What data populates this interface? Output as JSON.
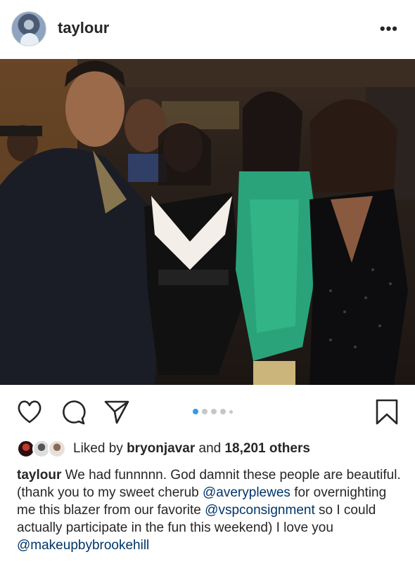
{
  "post": {
    "username": "taylour",
    "more_label": "•••"
  },
  "carousel": {
    "dot_count": 5,
    "active_index": 0
  },
  "likes": {
    "prefix": "Liked by",
    "user": "bryonjavar",
    "connector": "and",
    "count": "18,201 others"
  },
  "caption": {
    "username": "taylour",
    "part1": " We had funnnnn. God damnit these people are beautiful. (thank you to my sweet cherub ",
    "mention1": "@averyplewes",
    "part2": " for overnighting me this blazer from our favorite ",
    "mention2": "@vspconsignment",
    "part3": " so I could actually participate in the fun this weekend) I love you ",
    "mention3": "@makeupbybrookehill"
  },
  "icons": {
    "like": "heart-icon",
    "comment": "comment-icon",
    "share": "send-icon",
    "save": "bookmark-icon",
    "more": "more-dots-icon"
  },
  "colors": {
    "text": "#262626",
    "mention": "#003569",
    "active_dot": "#3897f0",
    "inactive_dot": "#c7c7c7"
  }
}
